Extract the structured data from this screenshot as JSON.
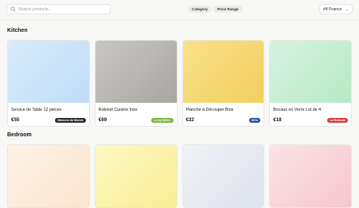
{
  "search": {
    "placeholder": "Search products..."
  },
  "filters": [
    "Category",
    "Price Range"
  ],
  "region": {
    "label": "#4 France"
  },
  "sections": [
    {
      "title": "Kitchen",
      "products": [
        {
          "name": "Service de Table 12 pièces",
          "price": "€55",
          "store": "Maisons du Monde",
          "badge_color": "#2b2b2b",
          "image_colors": [
            "#d7ecfb",
            "#bfdcf7"
          ]
        },
        {
          "name": "Robinet Cuisine Inox",
          "price": "€69",
          "store": "Leroy Merlin",
          "badge_color": "#77b83a",
          "image_colors": [
            "#c9c7c4",
            "#a9a6a2"
          ]
        },
        {
          "name": "Planche à Découper Bois",
          "price": "€22",
          "store": "IKEA",
          "badge_color": "#1e4fa8",
          "image_colors": [
            "#f9e28a",
            "#f1cf5e"
          ]
        },
        {
          "name": "Bocaux en Verre Lot de 4",
          "price": "€18",
          "store": "La Redoute",
          "badge_color": "#d83a3a",
          "image_colors": [
            "#d7f3e0",
            "#b6e9c6"
          ]
        }
      ]
    },
    {
      "title": "Bedroom",
      "products": [
        {
          "image_colors": [
            "#fdf2e4",
            "#f8e6cf"
          ]
        },
        {
          "image_colors": [
            "#fdf8c2",
            "#f7ee94"
          ]
        },
        {
          "image_colors": [
            "#eff1f6",
            "#dfe3ec"
          ]
        },
        {
          "image_colors": [
            "#fbe3e6",
            "#f5c7cd"
          ]
        }
      ]
    }
  ]
}
